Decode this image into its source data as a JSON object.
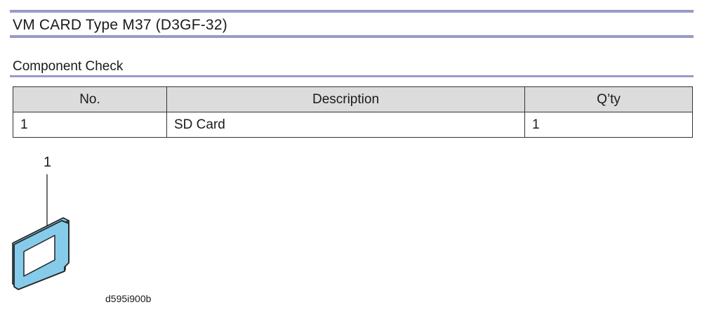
{
  "title": "VM CARD Type M37 (D3GF-32)",
  "section": "Component Check",
  "table": {
    "headers": [
      "No.",
      "Description",
      "Q’ty"
    ],
    "rows": [
      [
        "1",
        "SD Card",
        "1"
      ]
    ]
  },
  "figure": {
    "callout": "1",
    "id": "d595i900b",
    "card_color": "#7fc6e6",
    "outline_color": "#222222"
  }
}
